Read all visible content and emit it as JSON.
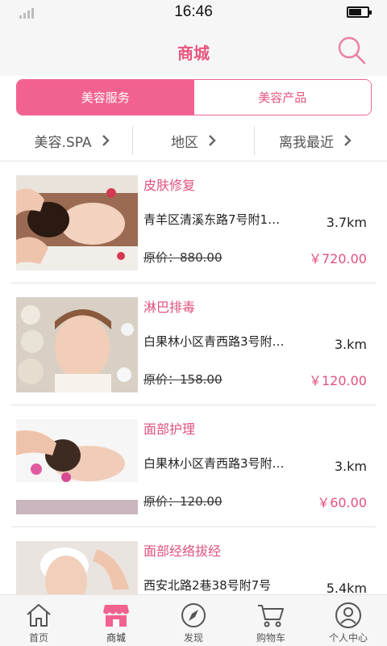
{
  "status_bar": {
    "time": "16:46",
    "battery_level_percent": 70
  },
  "header": {
    "title": "商城",
    "search_icon": "search-icon",
    "accent_color": "#e8567f"
  },
  "segments": {
    "active": "美容服务",
    "inactive": "美容产品"
  },
  "filters": [
    {
      "label": "美容.SPA"
    },
    {
      "label": "地区"
    },
    {
      "label": "离我最近"
    }
  ],
  "items": [
    {
      "title": "皮肤修复",
      "address": "青羊区清溪东路7号附1…",
      "distance": "3.7km",
      "original_price": "原价：880.00",
      "price": "￥720.00"
    },
    {
      "title": "淋巴排毒",
      "address": "白果林小区青西路3号附…",
      "distance": "3.km",
      "original_price": "原价：158.00",
      "price": "￥120.00"
    },
    {
      "title": "面部护理",
      "address": "白果林小区青西路3号附…",
      "distance": "3.km",
      "original_price": "原价：120.00",
      "price": "￥60.00"
    },
    {
      "title": "面部经络拔经",
      "address": "西安北路2巷38号附7号",
      "distance": "5.4km",
      "original_price": "",
      "price": ""
    }
  ],
  "tabbar": [
    {
      "label": "首页",
      "icon": "home-icon"
    },
    {
      "label": "商城",
      "icon": "store-icon"
    },
    {
      "label": "发现",
      "icon": "compass-icon"
    },
    {
      "label": "购物车",
      "icon": "cart-icon"
    },
    {
      "label": "个人中心",
      "icon": "user-icon"
    }
  ]
}
